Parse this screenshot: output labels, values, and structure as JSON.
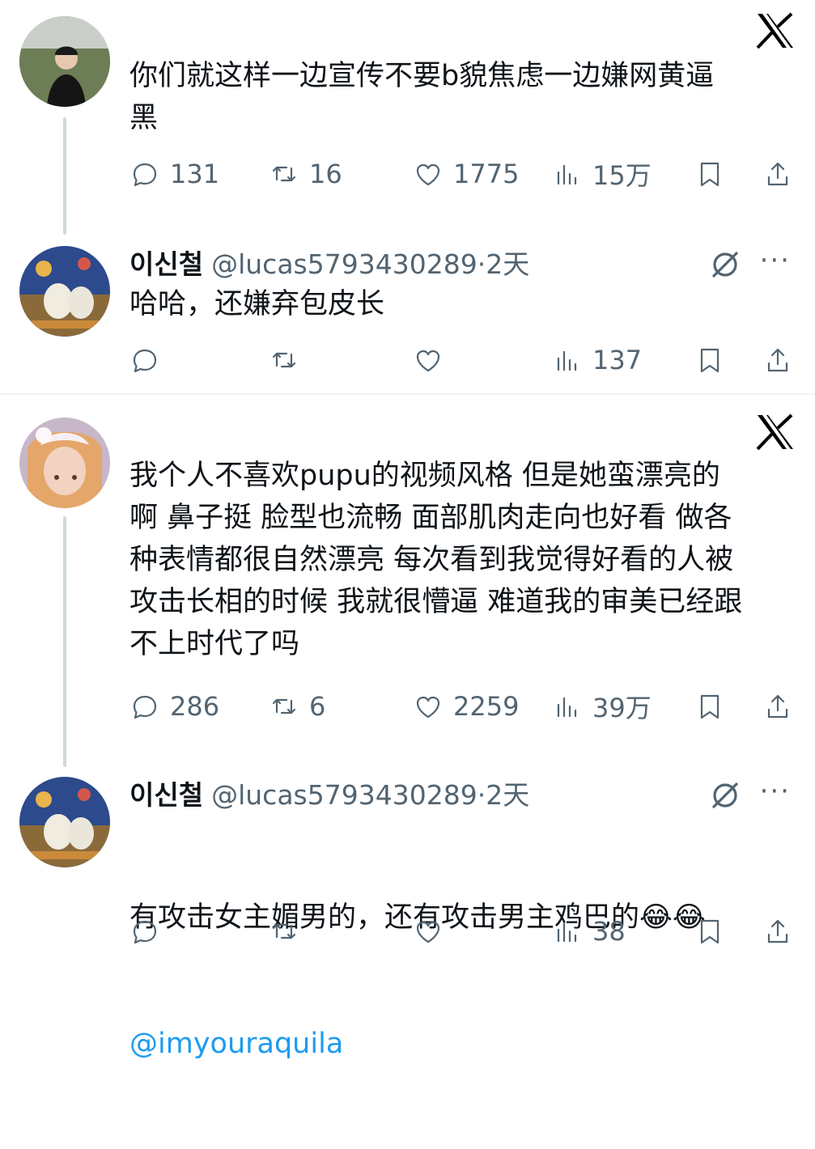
{
  "tweets": [
    {
      "text": "你们就这样一边宣传不要b貌焦虑一边嫌网黄逼\n黑",
      "replies": "131",
      "retweets": "16",
      "likes": "1775",
      "views": "15万"
    },
    {
      "name": "이신철",
      "handle": "@lucas5793430289",
      "time": "·2天",
      "text": "哈哈，还嫌弃包皮长",
      "replies": "",
      "retweets": "",
      "likes": "",
      "views": "137"
    },
    {
      "text": "我个人不喜欢pupu的视频风格 但是她蛮漂亮的\n啊 鼻子挺 脸型也流畅 面部肌肉走向也好看 做各\n种表情都很自然漂亮 每次看到我觉得好看的人被\n攻击长相的时候 我就很懵逼 难道我的审美已经跟\n不上时代了吗",
      "replies": "286",
      "retweets": "6",
      "likes": "2259",
      "views": "39万"
    },
    {
      "name": "이신철",
      "handle": "@lucas5793430289",
      "time": "·2天",
      "text": "有攻击女主媚男的，还有攻击男主鸡巴的😂😂",
      "mention": "@imyouraquila",
      "replies": "",
      "retweets": "",
      "likes": "",
      "views": "38"
    }
  ],
  "icons": {
    "reply": "comment-bubble-icon",
    "retweet": "retweet-icon",
    "like": "heart-icon",
    "views": "bar-chart-icon",
    "bookmark": "bookmark-icon",
    "share": "share-icon",
    "logo": "x-logo-icon",
    "grok": "grok-icon",
    "more": "more-dots-icon"
  },
  "colors": {
    "text": "#0f1419",
    "secondary": "#536471",
    "link": "#1d9bf0",
    "line": "#cfd9de"
  }
}
